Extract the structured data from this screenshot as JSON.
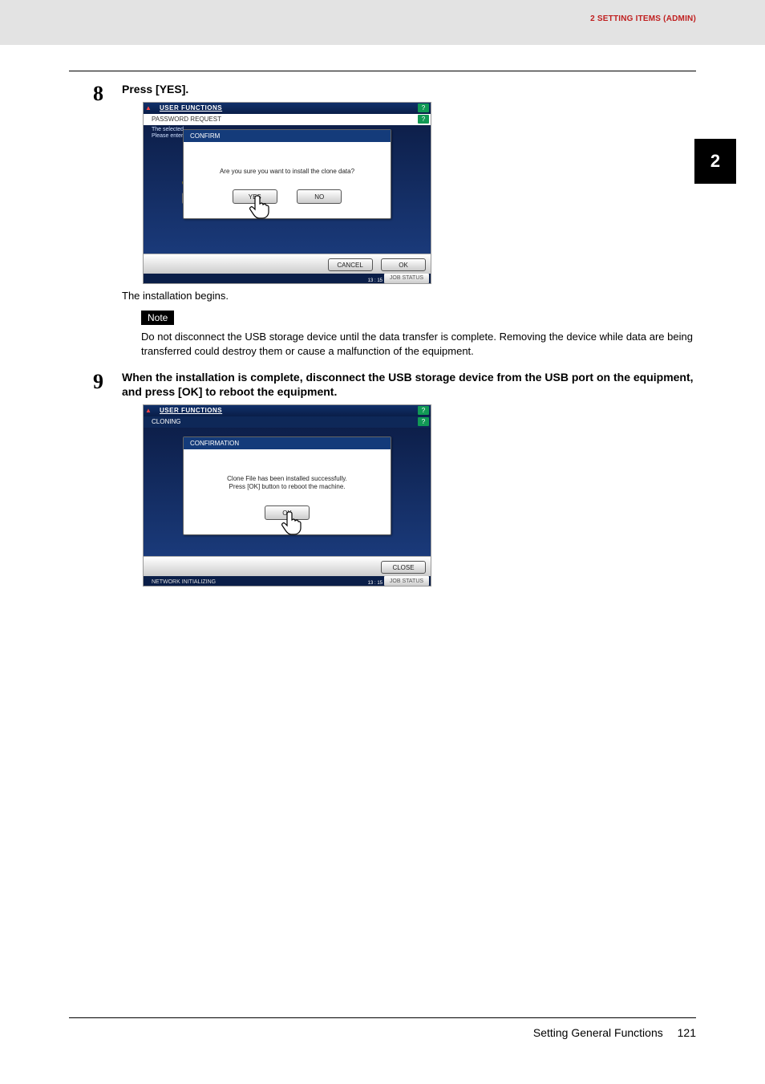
{
  "header": {
    "section_label": "2 SETTING ITEMS (ADMIN)"
  },
  "side_tab": "2",
  "steps": {
    "step8": {
      "num": "8",
      "title": "Press [YES].",
      "after_text": "The installation begins.",
      "note_label": "Note",
      "note_text": "Do not disconnect the USB storage device until the data transfer is complete. Removing the device while data are being transferred could destroy them or cause a malfunction of the equipment."
    },
    "step9": {
      "num": "9",
      "title": "When the installation is complete, disconnect the USB storage device from the USB port on the equipment, and press [OK] to reboot the equipment."
    }
  },
  "screenshot1": {
    "top_title": "USER FUNCTIONS",
    "sub_title": "PASSWORD REQUEST",
    "help": "?",
    "hint_line1": "The selected",
    "hint_line2": "Please enter",
    "dialog_title": "CONFIRM",
    "dialog_msg": "Are you sure you want to install the clone data?",
    "yes": "YES",
    "no": "NO",
    "cancel": "CANCEL",
    "ok": "OK",
    "job_status": "JOB STATUS",
    "time": "13 : 15"
  },
  "screenshot2": {
    "top_title": "USER FUNCTIONS",
    "sub_title": "CLONING",
    "help": "?",
    "dialog_title": "CONFIRMATION",
    "dialog_msg1": "Clone File has been installed successfully.",
    "dialog_msg2": "Press [OK] button to reboot the machine.",
    "ok": "OK",
    "close": "CLOSE",
    "job_status": "JOB STATUS",
    "status_left": "NETWORK INITIALIZING",
    "time": "13 : 15"
  },
  "footer": {
    "section": "Setting General Functions",
    "page": "121"
  }
}
